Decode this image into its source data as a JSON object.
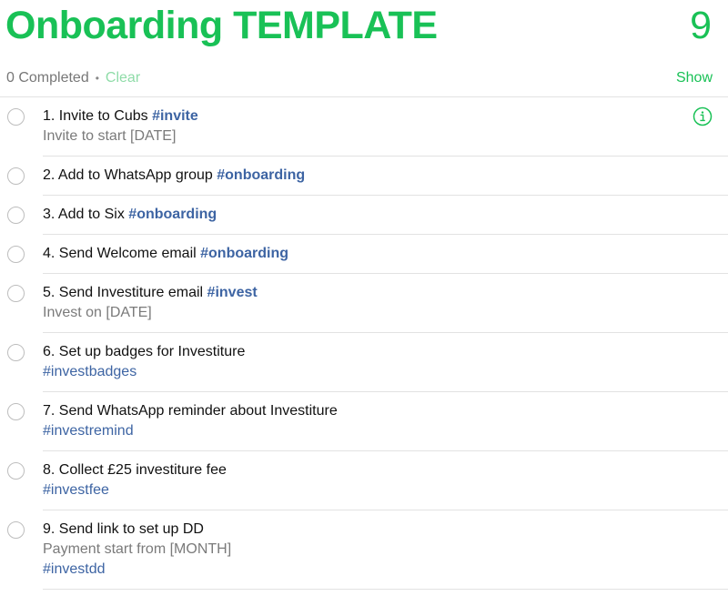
{
  "header": {
    "title": "Onboarding TEMPLATE",
    "count": "9",
    "completed_text": "0 Completed",
    "separator": "•",
    "clear_label": "Clear",
    "show_label": "Show"
  },
  "colors": {
    "accent": "#19c156",
    "tag": "#3d64a3"
  },
  "items": [
    {
      "title": "1. Invite to Cubs",
      "tag": "#invite",
      "tag_inline": true,
      "note": "Invite to start [DATE]",
      "info_icon": "info-circle-icon"
    },
    {
      "title": "2. Add to WhatsApp group",
      "tag": "#onboarding",
      "tag_inline": true
    },
    {
      "title": "3. Add to Six",
      "tag": "#onboarding",
      "tag_inline": true
    },
    {
      "title": "4. Send Welcome email",
      "tag": "#onboarding",
      "tag_inline": true
    },
    {
      "title": "5. Send Investiture email",
      "tag": "#invest",
      "tag_inline": true,
      "note": "Invest on [DATE]"
    },
    {
      "title": "6. Set up badges for Investiture",
      "tag": "#investbadges",
      "tag_inline": false
    },
    {
      "title": "7. Send WhatsApp reminder about Investiture",
      "tag": "#investremind",
      "tag_inline": false
    },
    {
      "title": "8. Collect £25 investiture fee",
      "tag": "#investfee",
      "tag_inline": false
    },
    {
      "title": "9. Send link to set up DD",
      "tag": "#investdd",
      "tag_inline": false,
      "note": "Payment start from [MONTH]"
    }
  ]
}
